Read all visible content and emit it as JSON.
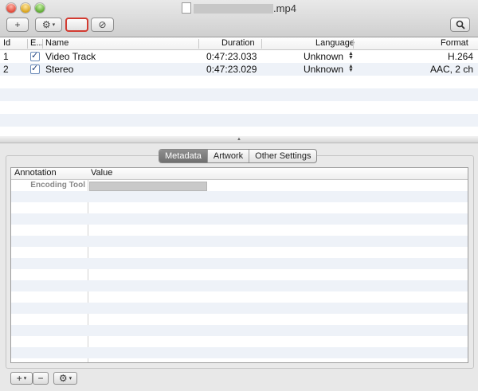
{
  "window": {
    "title_suffix": ".mp4"
  },
  "toolbar": {
    "add_label": "+",
    "gear_label": "⚙",
    "caret": "▾",
    "disable_label": "⊘",
    "search_label": "🔍"
  },
  "tracks": {
    "headers": [
      "Id",
      "E...",
      "Name",
      "Duration",
      "Language",
      "Format"
    ],
    "rows": [
      {
        "id": "1",
        "name": "Video Track",
        "duration": "0:47:23.033",
        "language": "Unknown",
        "format": "H.264"
      },
      {
        "id": "2",
        "name": "Stereo",
        "duration": "0:47:23.029",
        "language": "Unknown",
        "format": "AAC, 2 ch"
      }
    ]
  },
  "tabs": [
    "Metadata",
    "Artwork",
    "Other Settings"
  ],
  "metadata": {
    "headers": [
      "Annotation",
      "Value"
    ],
    "rows": [
      {
        "annotation": "Encoding Tool"
      }
    ]
  },
  "bottom": {
    "plus_label": "+",
    "minus_label": "−",
    "gear_label": "⚙",
    "caret": "▾"
  },
  "colors": {
    "highlight_border": "#d23b31",
    "active_tab": "#7a7a7a",
    "row_alt": "#eef2f8"
  }
}
